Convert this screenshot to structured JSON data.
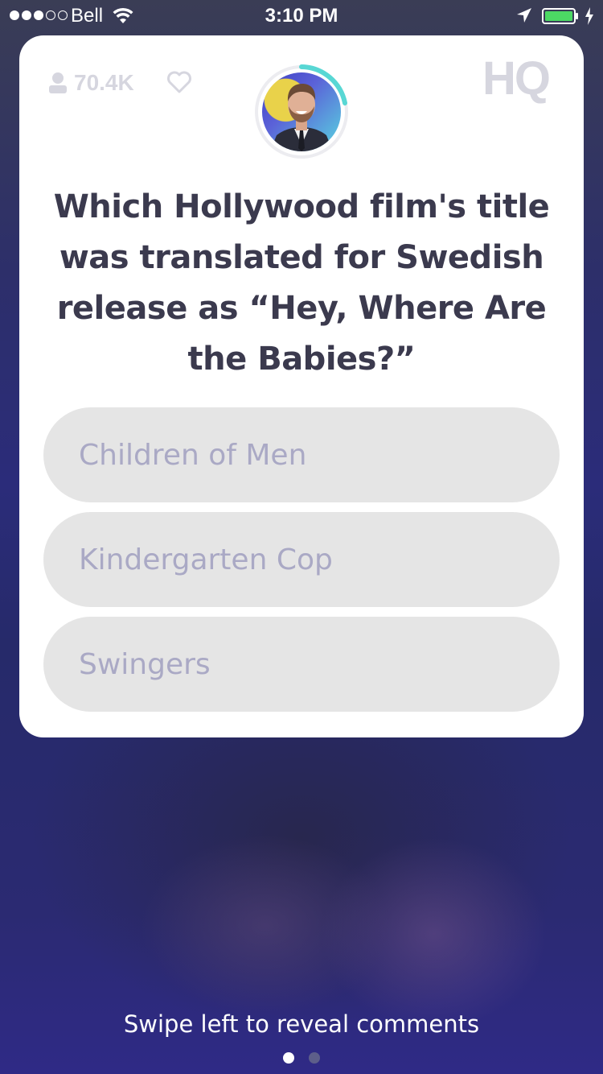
{
  "status_bar": {
    "carrier": "Bell",
    "time": "3:10 PM",
    "signal_bars_filled": 3,
    "signal_bars_total": 5,
    "battery_color": "#4cd964"
  },
  "card": {
    "viewer_count": "70.4K",
    "logo_text": "HQ",
    "question": "Which Hollywood film's title was translated for Swedish release as “Hey, Where Are the Babies?”",
    "answers": [
      {
        "label": "Children of Men"
      },
      {
        "label": "Kindergarten Cop"
      },
      {
        "label": "Swingers"
      }
    ],
    "timer_color": "#58d7d4"
  },
  "footer": {
    "swipe_hint": "Swipe left to reveal comments",
    "page_count": 2,
    "active_page": 1
  },
  "icons": [
    "wifi-icon",
    "location-icon",
    "battery-icon",
    "charging-icon",
    "person-icon",
    "heart-icon",
    "hq-logo"
  ]
}
